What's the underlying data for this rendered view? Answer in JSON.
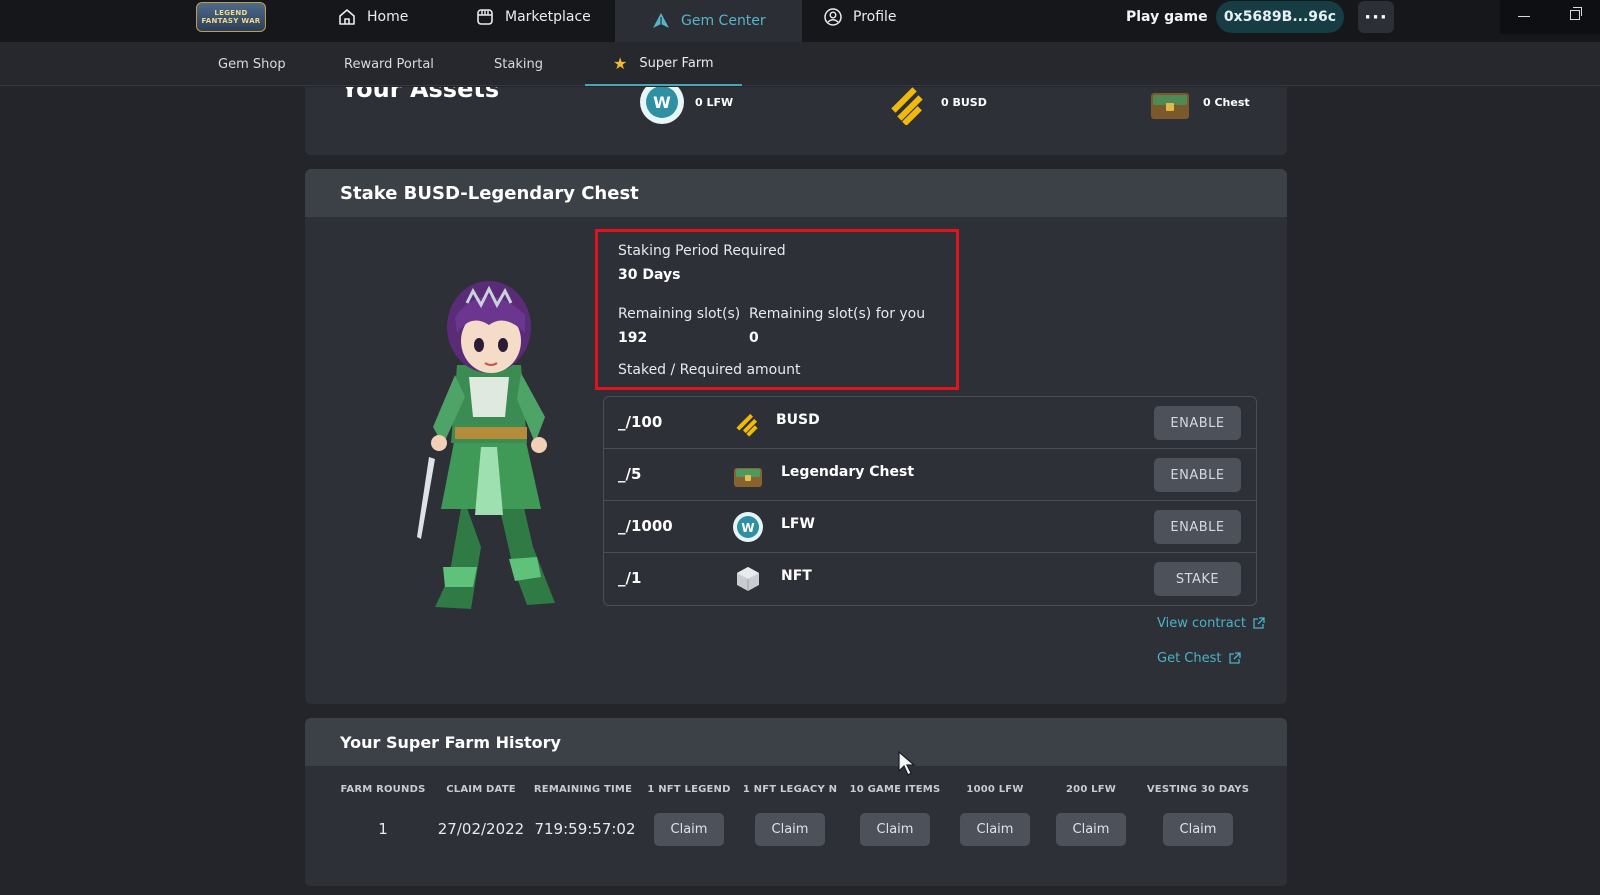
{
  "topbar": {
    "logo_line1": "LEGEND",
    "logo_line2": "FANTASY WAR",
    "nav": [
      {
        "label": "Home",
        "icon": "home-icon"
      },
      {
        "label": "Marketplace",
        "icon": "marketplace-icon"
      },
      {
        "label": "Gem Center",
        "icon": "gem-center-icon",
        "active": true
      },
      {
        "label": "Profile",
        "icon": "profile-icon"
      }
    ],
    "play_game": "Play game",
    "wallet": "0x5689B...96c",
    "more": "···"
  },
  "subnav": [
    {
      "label": "Gem Shop"
    },
    {
      "label": "Reward Portal"
    },
    {
      "label": "Staking"
    },
    {
      "label": "Super Farm",
      "active": true
    }
  ],
  "assets": {
    "title": "Your Assets",
    "items": [
      {
        "label": "0 LFW",
        "icon": "lfw-coin-icon"
      },
      {
        "label": "0 BUSD",
        "icon": "busd-coin-icon"
      },
      {
        "label": "0 Chest",
        "icon": "chest-icon"
      }
    ]
  },
  "stake": {
    "title": "Stake BUSD-Legendary Chest",
    "period_label": "Staking Period Required",
    "period_value": "30 Days",
    "remaining_label": "Remaining slot(s)",
    "remaining_value": "192",
    "remaining_you_label": "Remaining slot(s) for you",
    "remaining_you_value": "0",
    "amount_label": "Staked / Required amount",
    "rows": [
      {
        "amount": "_/100",
        "token": "BUSD",
        "icon": "busd-icon",
        "button": "ENABLE"
      },
      {
        "amount": "_/5",
        "token": "Legendary Chest",
        "icon": "legendary-chest-icon",
        "button": "ENABLE"
      },
      {
        "amount": "_/1000",
        "token": "LFW",
        "icon": "lfw-icon",
        "button": "ENABLE"
      },
      {
        "amount": "_/1",
        "token": "NFT",
        "icon": "nft-icon",
        "button": "STAKE"
      }
    ],
    "view_contract": "View contract",
    "get_chest": "Get Chest"
  },
  "history": {
    "title": "Your Super Farm History",
    "columns": [
      "FARM ROUNDS",
      "CLAIM DATE",
      "REMAINING TIME",
      "1 NFT LEGEND",
      "1 NFT LEGACY N",
      "10 GAME ITEMS",
      "1000 LFW",
      "200 LFW",
      "VESTING 30 DAYS"
    ],
    "row": {
      "round": "1",
      "date": "27/02/2022",
      "remaining": "719:59:57:02",
      "claims": [
        "Claim",
        "Claim",
        "Claim",
        "Claim",
        "Claim",
        "Claim"
      ]
    }
  },
  "colors": {
    "accent": "#4ab3c6",
    "highlight_border": "#e0141f",
    "panel": "#2d3037",
    "panel_head": "#3c4047",
    "button": "#4d525a"
  }
}
